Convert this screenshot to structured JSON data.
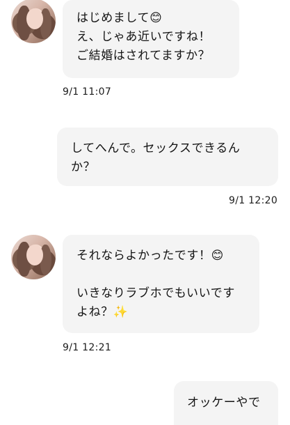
{
  "messages": [
    {
      "sender": "other",
      "lines": [
        "はじめまして😊",
        "え、じゃあ近いですね！",
        "ご結婚はされてますか？"
      ],
      "time": "9/1 11:07"
    },
    {
      "sender": "self",
      "lines": [
        "してへんで。セックスできるん",
        "か？"
      ],
      "time": "9/1 12:20"
    },
    {
      "sender": "other",
      "lines": [
        "それならよかったです！😊",
        "",
        "いきなりラブホでもいいです",
        "よね？✨"
      ],
      "time": "9/1 12:21"
    },
    {
      "sender": "self",
      "lines": [
        "オッケーやで"
      ],
      "time": ""
    }
  ],
  "colors": {
    "bubble": "#f4f4f4",
    "background": "#ffffff",
    "text": "#141414"
  }
}
